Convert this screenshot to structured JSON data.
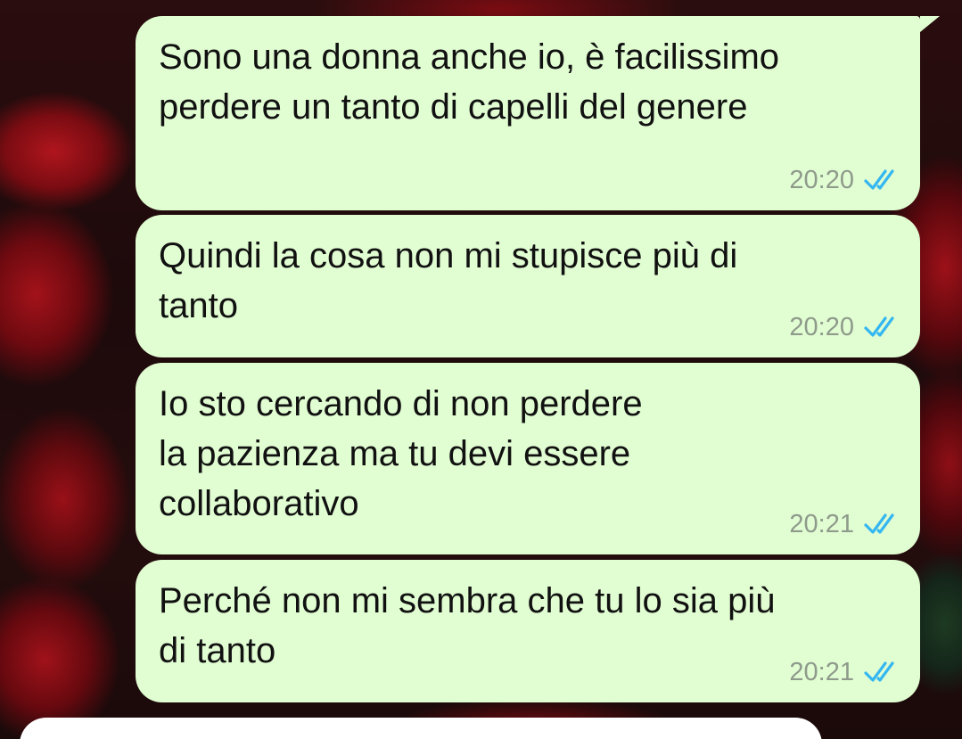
{
  "chat": {
    "messages": [
      {
        "text": "Sono una donna anche io, è facilissimo\nperdere un tanto di capelli del genere",
        "time": "20:20",
        "status_icon": "double-check-read-icon"
      },
      {
        "text": "Quindi la cosa non mi stupisce più di\ntanto",
        "time": "20:20",
        "status_icon": "double-check-read-icon"
      },
      {
        "text": "Io sto cercando di non perdere\nla pazienza ma tu devi essere\ncollaborativo",
        "time": "20:21",
        "status_icon": "double-check-read-icon"
      },
      {
        "text": "Perché non mi sembra che tu lo sia più\ndi tanto",
        "time": "20:21",
        "status_icon": "double-check-read-icon"
      }
    ]
  },
  "colors": {
    "outgoing_bubble": "#e1fdd2",
    "timestamp": "#8e9a8b",
    "read_ticks": "#34b7f1",
    "composer": "#ffffff"
  }
}
